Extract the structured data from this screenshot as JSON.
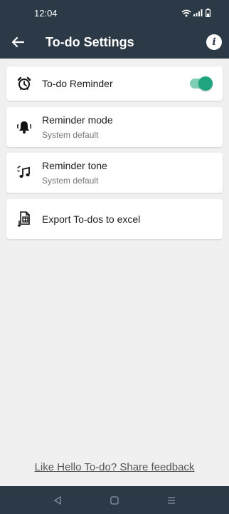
{
  "status_bar": {
    "time": "12:04"
  },
  "app_bar": {
    "title": "To-do Settings"
  },
  "settings": {
    "reminder": {
      "label": "To-do Reminder",
      "enabled": true
    },
    "reminder_mode": {
      "label": "Reminder mode",
      "value": "System default"
    },
    "reminder_tone": {
      "label": "Reminder tone",
      "value": "System default"
    },
    "export": {
      "label": "Export To-dos to excel"
    }
  },
  "feedback": {
    "text": "Like Hello To-do? Share feedback"
  },
  "colors": {
    "header": "#2c3a47",
    "background": "#f0f0f0",
    "toggle_on": "#1fa57f"
  },
  "icons": {
    "back": "arrow-left-icon",
    "info": "info-icon",
    "reminder": "alarm-clock-icon",
    "reminder_mode": "bell-ringing-icon",
    "reminder_tone": "music-note-icon",
    "export": "export-excel-icon"
  }
}
